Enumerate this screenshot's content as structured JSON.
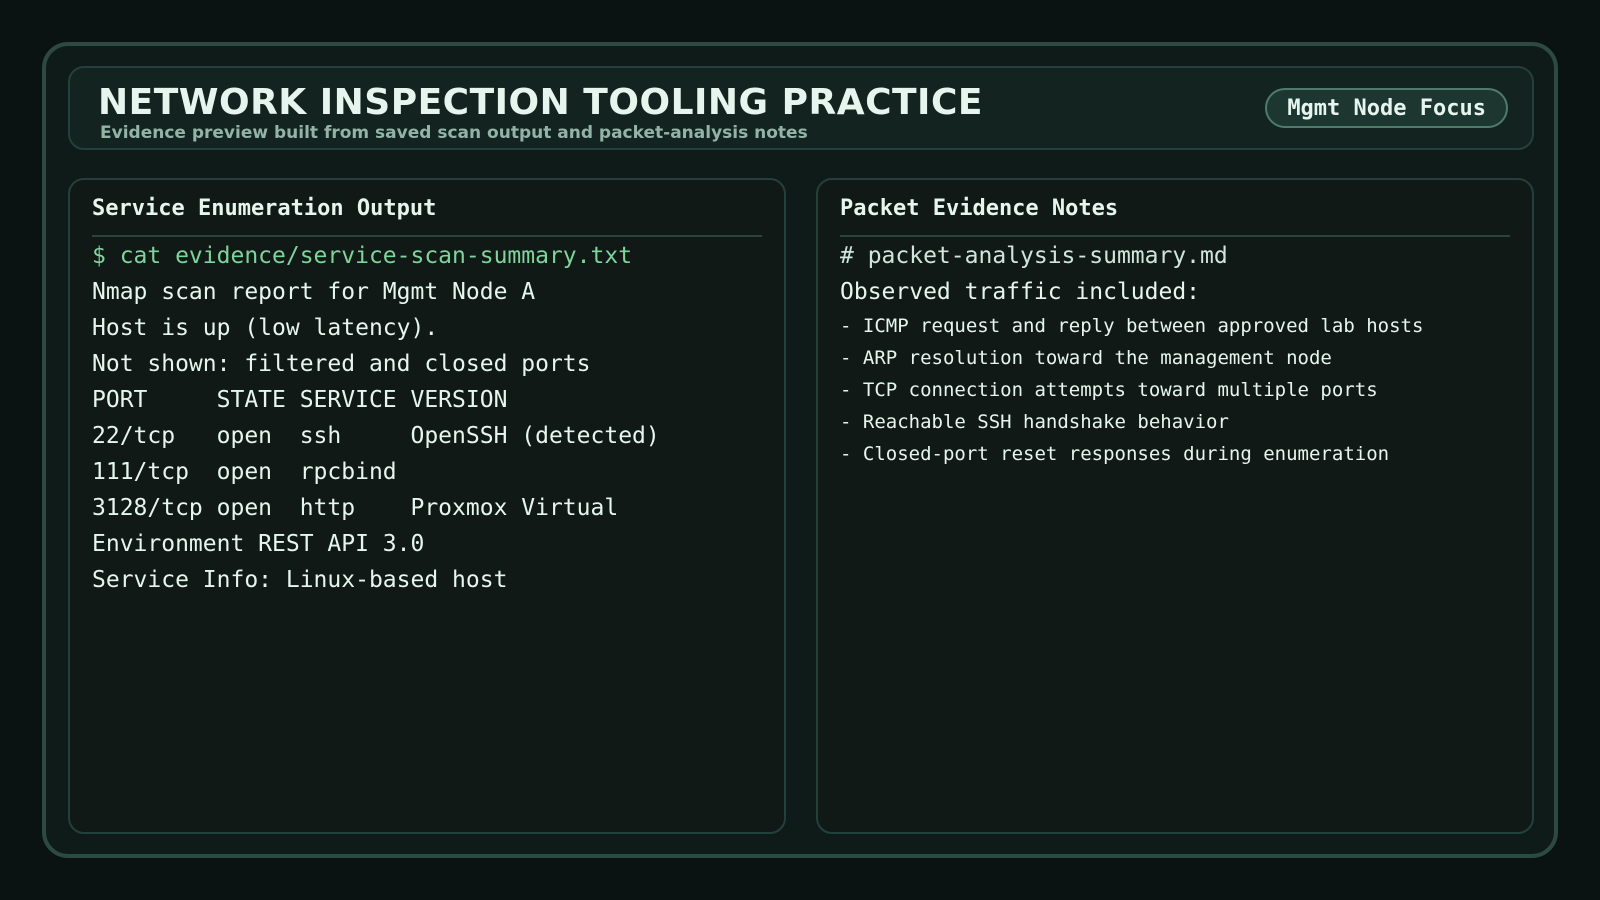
{
  "header": {
    "title": "NETWORK INSPECTION TOOLING PRACTICE",
    "subtitle": "Evidence preview built from saved scan output and packet-analysis notes",
    "badge": "Mgmt Node Focus"
  },
  "left_panel": {
    "title": "Service Enumeration Output",
    "command": "$ cat evidence/service-scan-summary.txt",
    "lines": [
      "Nmap scan report for Mgmt Node A",
      "Host is up (low latency).",
      "Not shown: filtered and closed ports",
      "PORT     STATE SERVICE VERSION",
      "22/tcp   open  ssh     OpenSSH (detected)",
      "111/tcp  open  rpcbind",
      "3128/tcp open  http    Proxmox Virtual",
      "Environment REST API 3.0",
      "Service Info: Linux-based host"
    ]
  },
  "right_panel": {
    "title": "Packet Evidence Notes",
    "file_heading": "# packet-analysis-summary.md",
    "intro": "Observed traffic included:",
    "bullets": [
      "- ICMP request and reply between approved lab hosts",
      "- ARP resolution toward the management node",
      "- TCP connection attempts toward multiple ports",
      "- Reachable SSH handshake behavior",
      "- Closed-port reset responses during enumeration"
    ]
  },
  "colors": {
    "background": "#0a1311",
    "accent_command": "#7fd49b",
    "text": "#e6f5ee",
    "border": "#2c4a42"
  }
}
